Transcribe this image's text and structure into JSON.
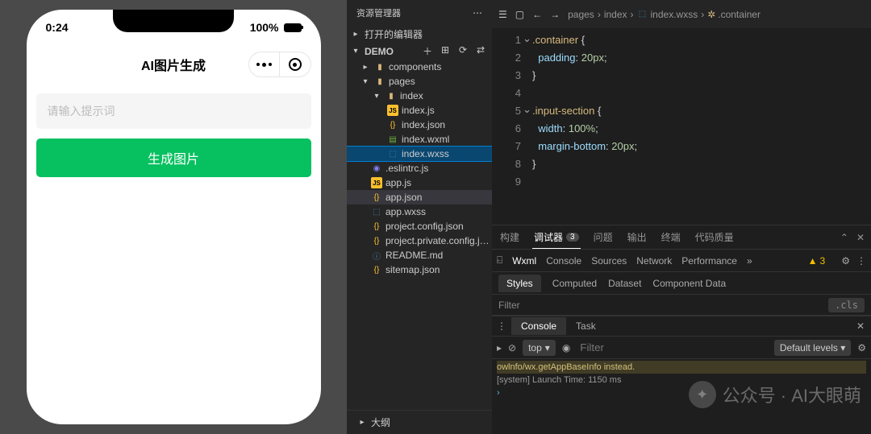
{
  "phone": {
    "status_time": "0:24",
    "battery_pct": "100%",
    "nav_title": "AI图片生成",
    "input_placeholder": "请输入提示词",
    "button_label": "生成图片"
  },
  "explorer": {
    "title": "资源管理器",
    "open_editors": "打开的编辑器",
    "project_name": "DEMO",
    "outline": "大纲",
    "tree": {
      "components": "components",
      "pages": "pages",
      "index": "index",
      "index_js": "index.js",
      "index_json": "index.json",
      "index_wxml": "index.wxml",
      "index_wxss": "index.wxss",
      "eslintrc": ".eslintrc.js",
      "app_js": "app.js",
      "app_json": "app.json",
      "app_wxss": "app.wxss",
      "project_config": "project.config.json",
      "project_private": "project.private.config.js...",
      "readme": "README.md",
      "sitemap": "sitemap.json"
    }
  },
  "breadcrumb": {
    "a": "pages",
    "b": "index",
    "c": "index.wxss",
    "d": ".container"
  },
  "code": {
    "l1": ".container {",
    "l2": "  padding: 20px;",
    "l3": "}",
    "l4": "",
    "l5": ".input-section {",
    "l6": "  width: 100%;",
    "l7": "  margin-bottom: 20px;",
    "l8": "}",
    "l9": ""
  },
  "panel": {
    "tabs": {
      "build": "构建",
      "debugger": "调试器",
      "issues": "问题",
      "output": "输出",
      "terminal": "终端",
      "quality": "代码质量"
    },
    "debugger_badge": "3"
  },
  "devtools": {
    "wxml": "Wxml",
    "console": "Console",
    "sources": "Sources",
    "network": "Network",
    "performance": "Performance",
    "warn_count": "3"
  },
  "styles": {
    "styles": "Styles",
    "computed": "Computed",
    "dataset": "Dataset",
    "cdata": "Component Data",
    "filter": "Filter",
    "cls": ".cls"
  },
  "console": {
    "tab_console": "Console",
    "tab_task": "Task",
    "scope": "top",
    "filter": "Filter",
    "levels": "Default levels ▾",
    "log1": "owlnfo/wx.getAppBaseInfo instead.",
    "log2": "[system] Launch Time: 1150 ms"
  },
  "watermark": "公众号 · AI大眼萌"
}
